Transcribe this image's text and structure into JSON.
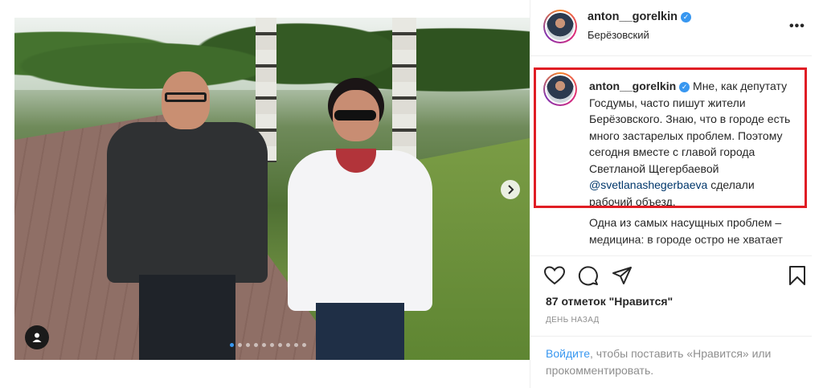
{
  "post": {
    "username": "anton__gorelkin",
    "location": "Берёзовский",
    "more_label": "•••",
    "caption_highlighted": {
      "before_mention": "Мне, как депутату Госдумы, часто пишут жители Берёзовского. Знаю, что в городе есть много застарелых проблем. Поэтому сегодня вместе с главой города Светланой Щегербаевой",
      "mention": "@svetlanashegerbaeva",
      "after_mention": "сделали рабочий объезд."
    },
    "caption_continued": "Одна из самых насущных проблем – медицина: в городе остро не хватает",
    "likes": "87 отметок \"Нравится\"",
    "time": "ДЕНЬ НАЗАД",
    "login_link": "Войдите",
    "login_text": ", чтобы поставить «Нравится» или прокомментировать."
  },
  "carousel": {
    "count": 10,
    "active_index": 0
  },
  "icons": {
    "verified": "verified-badge-icon",
    "next": "chevron-right-icon",
    "user_tag": "user-tag-icon",
    "like": "heart-icon",
    "comment": "comment-icon",
    "share": "share-icon",
    "save": "bookmark-icon"
  },
  "colors": {
    "highlight_border": "#e01d24",
    "link": "#3897f0",
    "mention": "#00376b"
  }
}
